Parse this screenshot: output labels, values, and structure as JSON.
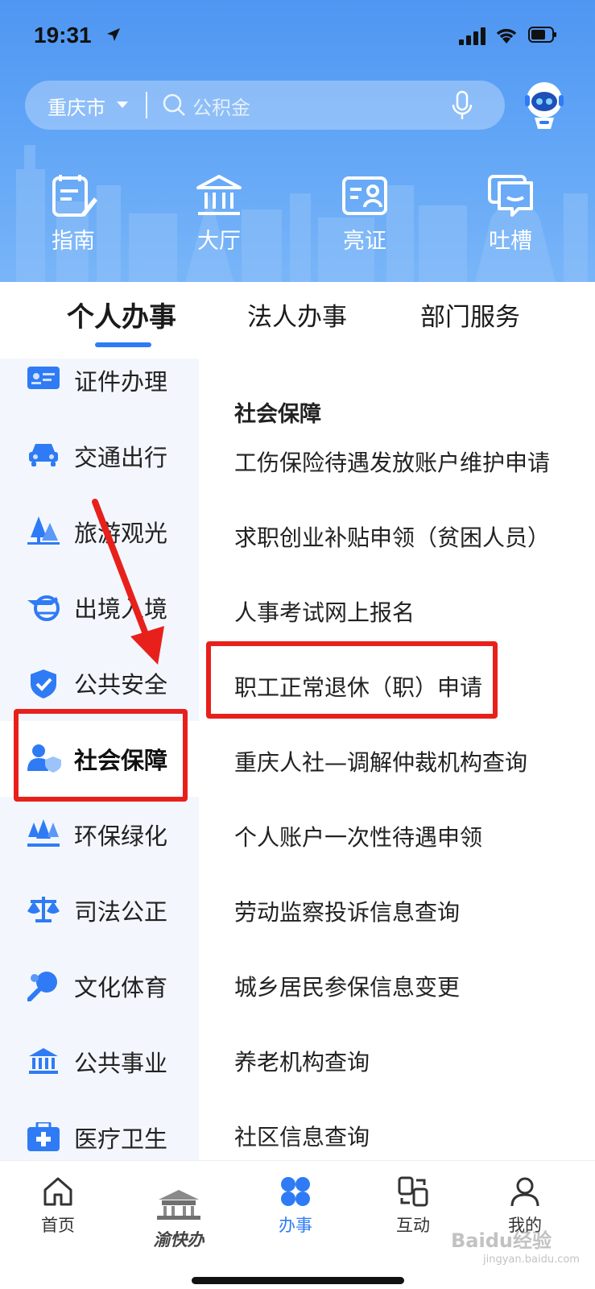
{
  "status_bar": {
    "time": "19:31"
  },
  "search": {
    "city": "重庆市",
    "placeholder": "公积金"
  },
  "quick_actions": [
    {
      "label": "指南",
      "icon": "guide-icon"
    },
    {
      "label": "大厅",
      "icon": "hall-icon"
    },
    {
      "label": "亮证",
      "icon": "id-card-icon"
    },
    {
      "label": "吐槽",
      "icon": "feedback-icon"
    }
  ],
  "tabs": [
    {
      "label": "个人办事",
      "active": true
    },
    {
      "label": "法人办事",
      "active": false
    },
    {
      "label": "部门服务",
      "active": false
    }
  ],
  "sidebar": {
    "items": [
      {
        "label": "证件办理",
        "icon": "id-card-icon"
      },
      {
        "label": "交通出行",
        "icon": "car-icon"
      },
      {
        "label": "旅游观光",
        "icon": "trees-icon"
      },
      {
        "label": "出境入境",
        "icon": "plane-globe-icon"
      },
      {
        "label": "公共安全",
        "icon": "shield-check-icon"
      },
      {
        "label": "社会保障",
        "icon": "person-shield-icon",
        "active": true
      },
      {
        "label": "环保绿化",
        "icon": "pine-trees-icon"
      },
      {
        "label": "司法公正",
        "icon": "scales-icon"
      },
      {
        "label": "文化体育",
        "icon": "ping-pong-icon"
      },
      {
        "label": "公共事业",
        "icon": "building-columns-icon"
      },
      {
        "label": "医疗卫生",
        "icon": "medical-kit-icon"
      }
    ]
  },
  "content": {
    "section_title": "社会保障",
    "services": [
      "工伤保险待遇发放账户维护申请",
      "求职创业补贴申领（贫困人员）",
      "人事考试网上报名",
      "职工正常退休（职）申请",
      "重庆人社—调解仲裁机构查询",
      "个人账户一次性待遇申领",
      "劳动监察投诉信息查询",
      "城乡居民参保信息变更",
      "养老机构查询",
      "社区信息查询"
    ]
  },
  "bottom_nav": [
    {
      "label": "首页",
      "icon": "home-icon"
    },
    {
      "label": "渝快办",
      "icon": "yukuaiban-logo-icon"
    },
    {
      "label": "办事",
      "icon": "grid-clover-icon",
      "active": true
    },
    {
      "label": "互动",
      "icon": "interact-icon"
    },
    {
      "label": "我的",
      "icon": "user-icon"
    }
  ],
  "watermark": {
    "text": "Baidu经验",
    "sub": "jingyan.baidu.com"
  },
  "colors": {
    "accent": "#2f7bf5",
    "annotation": "#e8201c",
    "header": "#5fa4f6"
  }
}
